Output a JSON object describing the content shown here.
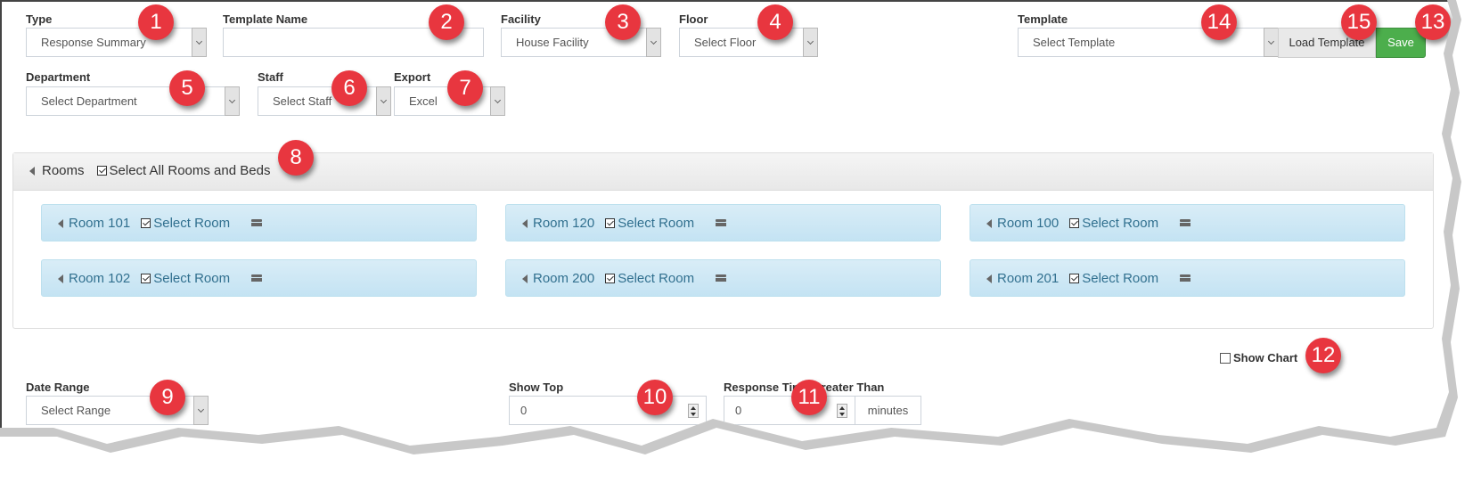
{
  "filters": {
    "type": {
      "label": "Type",
      "value": "Response Summary"
    },
    "template_name": {
      "label": "Template Name",
      "value": "",
      "placeholder": ""
    },
    "facility": {
      "label": "Facility",
      "value": "House Facility"
    },
    "floor": {
      "label": "Floor",
      "value": "Select Floor"
    },
    "department": {
      "label": "Department",
      "value": "Select Department"
    },
    "staff": {
      "label": "Staff",
      "value": "Select Staff"
    },
    "export": {
      "label": "Export",
      "value": "Excel"
    },
    "template": {
      "label": "Template",
      "value": "Select Template"
    }
  },
  "buttons": {
    "load_template": "Load Template",
    "save": "Save"
  },
  "rooms_panel": {
    "title": "Rooms",
    "select_all_label": "Select All Rooms and Beds",
    "select_all_checked": true,
    "rooms": [
      {
        "name": "Room 101",
        "select_label": "Select Room",
        "checked": true
      },
      {
        "name": "Room 120",
        "select_label": "Select Room",
        "checked": true
      },
      {
        "name": "Room 100",
        "select_label": "Select Room",
        "checked": true
      },
      {
        "name": "Room 102",
        "select_label": "Select Room",
        "checked": true
      },
      {
        "name": "Room 200",
        "select_label": "Select Room",
        "checked": true
      },
      {
        "name": "Room 201",
        "select_label": "Select Room",
        "checked": true
      }
    ]
  },
  "show_chart": {
    "label": "Show Chart",
    "checked": false
  },
  "date_range": {
    "label": "Date Range",
    "value": "Select Range"
  },
  "show_top": {
    "label": "Show Top",
    "value": "0"
  },
  "response_time": {
    "label": "Response Time Greater Than",
    "value": "0",
    "unit": "minutes"
  },
  "markers": [
    "1",
    "2",
    "3",
    "4",
    "5",
    "6",
    "7",
    "8",
    "9",
    "10",
    "11",
    "12",
    "13",
    "14",
    "15"
  ],
  "colors": {
    "save_green": "#4cae4c",
    "marker_red": "#e8363f",
    "room_text": "#31708f"
  }
}
